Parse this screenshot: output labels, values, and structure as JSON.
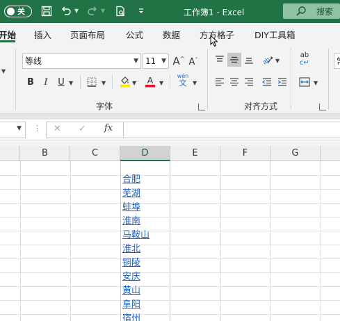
{
  "titlebar": {
    "autosave_label": "关",
    "doc_title": "工作簿1  -  Excel",
    "search_label": "搜索",
    "icons": [
      "save-icon",
      "undo-icon",
      "redo-icon",
      "print-preview-icon",
      "customize-toolbar-icon"
    ]
  },
  "tabs": [
    {
      "label": "开始",
      "active": true
    },
    {
      "label": "插入"
    },
    {
      "label": "页面布局"
    },
    {
      "label": "公式"
    },
    {
      "label": "数据"
    },
    {
      "label": "方方格子"
    },
    {
      "label": "DIY工具箱"
    }
  ],
  "ribbon": {
    "font_name": "等线",
    "font_size": "11",
    "grow_font": "A",
    "shrink_font": "A",
    "bold": "B",
    "italic": "I",
    "underline": "U",
    "phonetic_top": "wén",
    "phonetic_bottom": "文",
    "group_font_label": "字体",
    "group_align_label": "对齐方式",
    "wrap_label_top": "ab",
    "wrap_label_bottom": "c",
    "number_partial": "常"
  },
  "formula_bar": {
    "cancel": "✕",
    "enter": "✓",
    "fx": "fx",
    "value": ""
  },
  "grid": {
    "columns": [
      "B",
      "C",
      "D",
      "E",
      "F",
      "G"
    ],
    "selected_column": "D",
    "cells_d": [
      "合肥",
      "芜湖",
      "蚌埠",
      "淮南",
      "马鞍山",
      "淮北",
      "铜陵",
      "安庆",
      "黄山",
      "阜阳",
      "宿州"
    ]
  },
  "colors": {
    "accent": "#217346",
    "link": "#1f5fbf",
    "font_color": "#e81123",
    "highlight": "#ffe600"
  }
}
